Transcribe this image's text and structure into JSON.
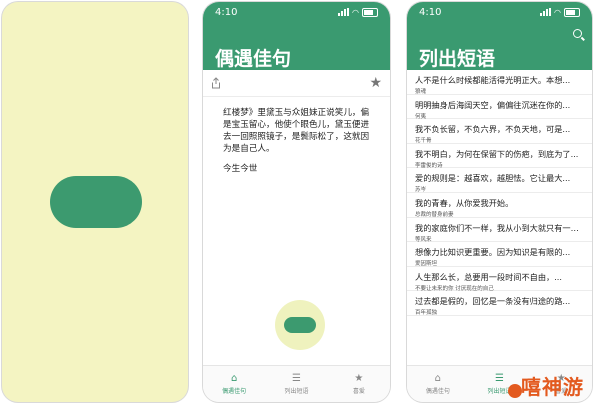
{
  "status": {
    "time": "4:10"
  },
  "detail": {
    "title": "偶遇佳句",
    "quote": "红楼梦》里黛玉与众姐妹正说笑儿，偏是宝玉留心，他使个眼色儿，黛玉便进去一回照照镜子，是鬓际松了，这就因为是自己人。",
    "source": "今生今世"
  },
  "list": {
    "title": "列出短语",
    "items": [
      {
        "text": "人不是什么时候都能活得光明正大。本想...",
        "author": "狼魂"
      },
      {
        "text": "明明抽身后海阔天空，偏偏往沉迷在你的...",
        "author": "何夷"
      },
      {
        "text": "我不负长留，不负六界，不负天地，可是...",
        "author": "花千骨"
      },
      {
        "text": "我不明白，为何在保留下的伤疤，到底为了...",
        "author": "李雷俊的诗"
      },
      {
        "text": "爱的规则是：越喜欢，越胆怯。它让最大...",
        "author": "苏岑"
      },
      {
        "text": "我的青春，从你爱我开始。",
        "author": "总裁的替身前妻"
      },
      {
        "text": "我的家庭你们不一样，我从小到大就只有一个...",
        "author": "等风来"
      },
      {
        "text": "想像力比知识更重要。因为知识是有限的...",
        "author": "爱因斯坦"
      },
      {
        "text": "人生那么长，总要用一段时间不自由，...",
        "author": "不要让未来的你 讨厌现在的自己"
      },
      {
        "text": "过去都是假的，回忆是一条没有归途的路...",
        "author": "百年孤独"
      }
    ]
  },
  "tabs": [
    "偶遇佳句",
    "列出短语",
    "喜爱"
  ],
  "watermark": "嘻神游"
}
